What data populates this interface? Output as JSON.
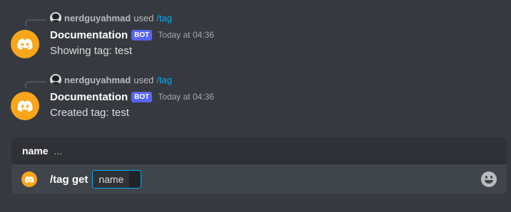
{
  "messages": [
    {
      "reply": {
        "user": "nerdguyahmad",
        "used": "used",
        "command": "/tag"
      },
      "author": "Documentation",
      "bot_tag": "BOT",
      "timestamp": "Today at 04:36",
      "content": "Showing tag: test"
    },
    {
      "reply": {
        "user": "nerdguyahmad",
        "used": "used",
        "command": "/tag"
      },
      "author": "Documentation",
      "bot_tag": "BOT",
      "timestamp": "Today at 04:36",
      "content": "Created tag: test"
    }
  ],
  "autocomplete": {
    "option_name": "name",
    "ellipsis": "..."
  },
  "composer": {
    "command": "/tag get",
    "option_label": "name"
  },
  "colors": {
    "background": "#36393f",
    "bot_avatar": "#faa61a",
    "bot_tag": "#5865f2",
    "link": "#00aff4"
  },
  "icons": {
    "avatar": "discord-logo-icon",
    "emoji": "emoji-icon"
  }
}
